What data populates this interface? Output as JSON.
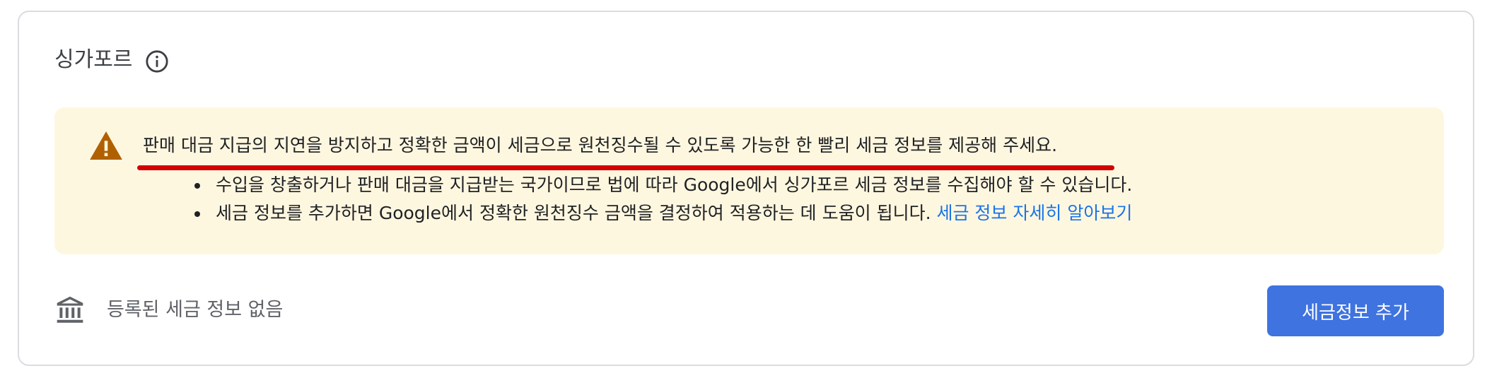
{
  "section": {
    "title": "싱가포르",
    "info_icon": "info-icon"
  },
  "warning": {
    "icon": "warning-icon",
    "icon_color": "#b06000",
    "underline_color": "#d40000",
    "background": "#fef7e0",
    "main_text": "판매 대금 지급의 지연을 방지하고 정확한 금액이 세금으로 원천징수될 수 있도록 가능한 한 빨리 세금 정보를 제공해 주세요.",
    "bullets": [
      {
        "text": "수입을 창출하거나 판매 대금을 지급받는 국가이므로 법에 따라 Google에서 싱가포르 세금 정보를 수집해야 할 수 있습니다."
      },
      {
        "text": "세금 정보를 추가하면 Google에서 정확한 원천징수 금액을 결정하여 적용하는 데 도움이 됩니다. ",
        "link": "세금 정보 자세히 알아보기"
      }
    ]
  },
  "footer": {
    "icon": "bank-icon",
    "empty_text": "등록된 세금 정보 없음",
    "add_button_label": "세금정보 추가",
    "button_color": "#3e73e0"
  }
}
